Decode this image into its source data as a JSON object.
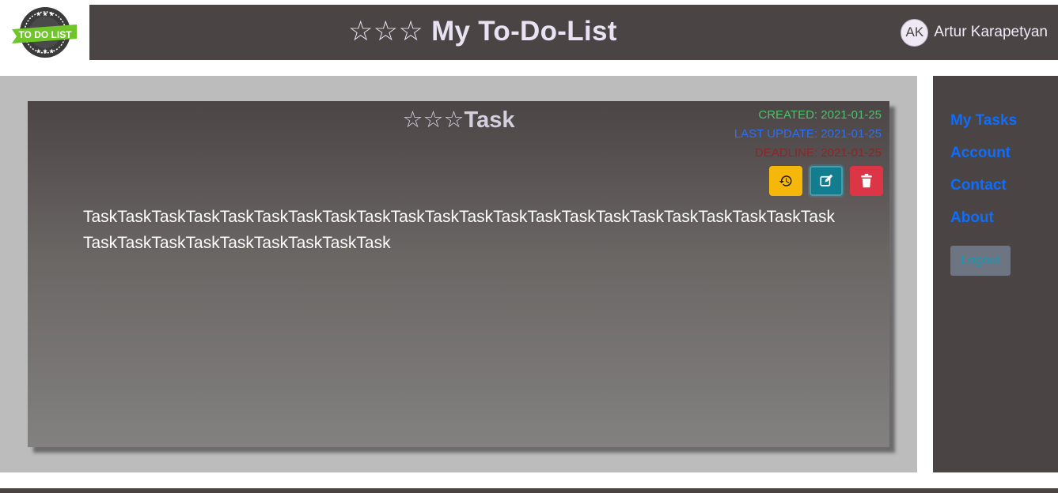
{
  "header": {
    "logo_text": "TO DO LIST",
    "title_stars": "☆☆☆",
    "title": "My To-Do-List",
    "user_initials": "AK",
    "user_name": "Artur Karapetyan"
  },
  "task": {
    "stars": "☆☆☆",
    "title": "Task",
    "created_label": "CREATED: 2021-01-25",
    "updated_label": "LAST UPDATE: 2021-01-25",
    "deadline_label": "DEADLINE: 2021-01-25",
    "text": "TaskTaskTaskTaskTaskTaskTaskTaskTaskTaskTaskTaskTaskTaskTaskTaskTaskTaskTaskTaskTaskTaskTaskTaskTaskTaskTaskTaskTaskTaskTask",
    "actions": [
      {
        "name": "history-button",
        "icon": "history-icon"
      },
      {
        "name": "edit-button",
        "icon": "edit-icon"
      },
      {
        "name": "delete-button",
        "icon": "trash-icon"
      }
    ]
  },
  "sidebar": {
    "items": [
      {
        "label": "My Tasks"
      },
      {
        "label": "Account"
      },
      {
        "label": "Contact"
      },
      {
        "label": "About"
      }
    ],
    "logout_label": "Logout"
  },
  "colors": {
    "header_bg": "#4a4444",
    "content_bg": "#bdbcbd",
    "link": "#0d6efd",
    "history_btn": "#f5b80a",
    "edit_btn": "#137d90",
    "delete_btn": "#dc3545",
    "created": "#4fc06a",
    "updated": "#2f6ff2",
    "deadline": "#8a2727"
  }
}
